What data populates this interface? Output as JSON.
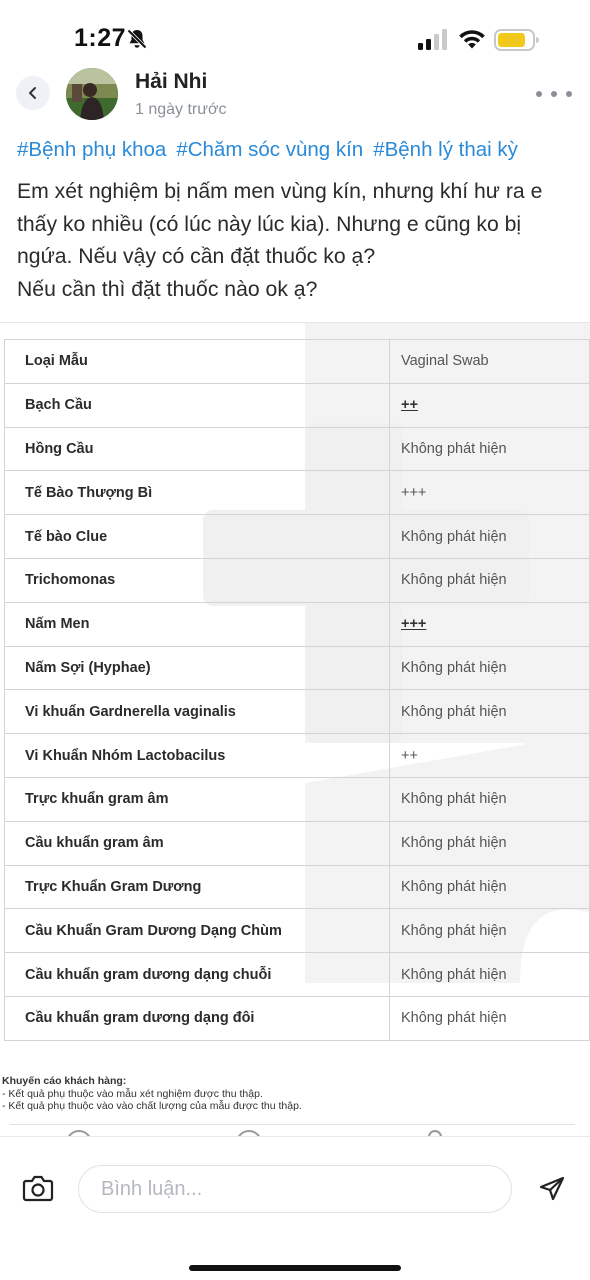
{
  "status_bar": {
    "time": "1:27"
  },
  "post": {
    "author_name": "Hải Nhi",
    "time_ago": "1 ngày trước",
    "hashtags": [
      "#Bệnh phụ khoa",
      "#Chăm sóc vùng kín",
      "#Bệnh lý thai kỳ"
    ],
    "body_lines": [
      "Em xét nghiệm bị nấm men vùng kín, nhưng khí hư ra e",
      "thấy ko nhiều (có lúc này lúc kia). Nhưng e cũng ko bị",
      "ngứa. Nếu vậy có cần đặt thuốc ko ạ?",
      "Nếu cần thì đặt thuốc nào ok ạ?"
    ]
  },
  "lab_table": {
    "rows": [
      {
        "name": "Loại Mẫu",
        "value": "Vaginal Swab"
      },
      {
        "name": "Bạch Cầu",
        "value": "++"
      },
      {
        "name": "Hồng Cầu",
        "value": "Không phát hiện"
      },
      {
        "name": "Tế Bào Thượng Bì",
        "value": "+++"
      },
      {
        "name": "Tế bào Clue",
        "value": "Không phát hiện"
      },
      {
        "name": "Trichomonas",
        "value": "Không phát hiện"
      },
      {
        "name": "Nấm Men",
        "value": "+++"
      },
      {
        "name": "Nấm Sợi (Hyphae)",
        "value": "Không phát hiện"
      },
      {
        "name": "Vi khuẩn Gardnerella vaginalis",
        "value": "Không phát hiện"
      },
      {
        "name": "Vi Khuẩn Nhóm Lactobacilus",
        "value": "++"
      },
      {
        "name": "Trực khuẩn gram âm",
        "value": "Không phát hiện"
      },
      {
        "name": "Cầu khuẩn gram âm",
        "value": "Không phát hiện"
      },
      {
        "name": "Trực Khuẩn Gram Dương",
        "value": "Không phát hiện"
      },
      {
        "name": "Cầu Khuẩn Gram Dương Dạng Chùm",
        "value": "Không phát hiện"
      },
      {
        "name": "Cầu khuẩn gram dương dạng chuỗi",
        "value": "Không phát hiện"
      },
      {
        "name": "Cầu khuẩn gram dương dạng đôi",
        "value": "Không phát hiện"
      }
    ],
    "advisory": {
      "title": "Khuyến cáo khách hàng:",
      "lines": [
        "- Kết quả phụ thuộc vào mẫu xét nghiệm được thu thập.",
        "- Kết quả phụ thuộc vào vào chất lượng của mẫu được thu thập."
      ]
    }
  },
  "composer": {
    "placeholder": "Bình luận..."
  },
  "colors": {
    "hashtag": "#2a8ad8",
    "battery": "#f2c81a"
  },
  "icons": [
    "mute-icon",
    "signal-icon",
    "wifi-icon",
    "battery-icon",
    "chevron-left-icon",
    "more-dots-icon",
    "camera-icon",
    "send-icon"
  ]
}
